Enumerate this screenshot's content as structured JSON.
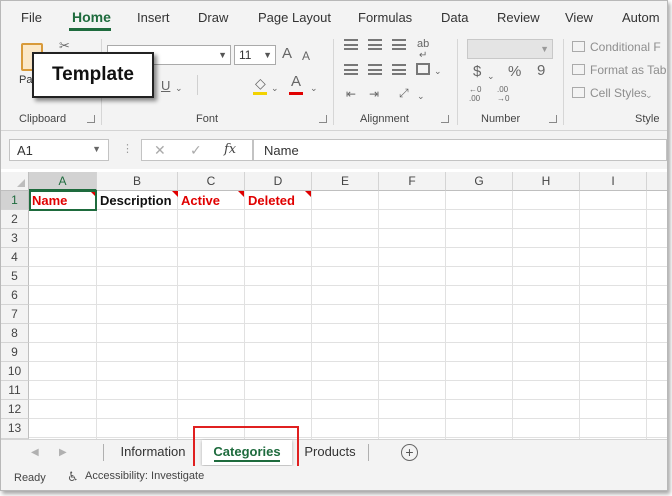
{
  "menu": [
    "File",
    "Home",
    "Insert",
    "Draw",
    "Page Layout",
    "Formulas",
    "Data",
    "Review",
    "View",
    "Autom"
  ],
  "ribbon": {
    "groups": {
      "clipboard": "Clipboard",
      "font": "Font",
      "alignment": "Alignment",
      "number": "Number",
      "styles": "Style"
    },
    "paste_label": "Pa",
    "font_size": "11",
    "font_grow": "A",
    "font_shrink": "A",
    "underline": "U",
    "font_color": "A",
    "currency": "$",
    "percent": "%",
    "comma": "9",
    "conditional_formatting": "Conditional F",
    "format_as_table": "Format as Tab",
    "cell_styles": "Cell Styles"
  },
  "tooltip": {
    "text": "Template"
  },
  "formula_bar": {
    "name_box": "A1",
    "fx": "fx",
    "value": "Name"
  },
  "grid": {
    "columns": [
      "A",
      "B",
      "C",
      "D",
      "E",
      "F",
      "G",
      "H",
      "I"
    ],
    "rows": [
      "1",
      "2",
      "3",
      "4",
      "5",
      "6",
      "7",
      "8",
      "9",
      "10",
      "11",
      "12",
      "13"
    ],
    "cells": {
      "A1": "Name",
      "B1": "Description",
      "C1": "Active",
      "D1": "Deleted"
    },
    "error_color": "#e00000"
  },
  "sheet_tabs": [
    "Information",
    "Categories",
    "Products"
  ],
  "active_sheet": "Categories",
  "status": {
    "ready": "Ready",
    "accessibility": "Accessibility: Investigate"
  },
  "colors": {
    "accent": "#1e6b3d",
    "highlight_box": "#e02020"
  }
}
